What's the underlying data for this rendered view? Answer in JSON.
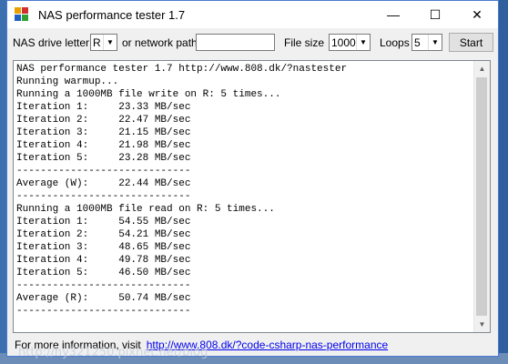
{
  "window": {
    "title": "NAS performance tester 1.7"
  },
  "titlebar": {
    "minimize": "—",
    "maximize": "☐",
    "close": "✕"
  },
  "toolbar": {
    "drive_label": "NAS drive letter",
    "drive_value": "R",
    "network_label": "or network path",
    "network_value": "",
    "filesize_label": "File size",
    "filesize_value": "1000",
    "loops_label": "Loops",
    "loops_value": "5",
    "start_label": "Start"
  },
  "output": {
    "lines": [
      "NAS performance tester 1.7 http://www.808.dk/?nastester",
      "Running warmup...",
      "Running a 1000MB file write on R: 5 times...",
      "Iteration 1:     23.33 MB/sec",
      "Iteration 2:     22.47 MB/sec",
      "Iteration 3:     21.15 MB/sec",
      "Iteration 4:     21.98 MB/sec",
      "Iteration 5:     23.28 MB/sec",
      "-----------------------------",
      "Average (W):     22.44 MB/sec",
      "-----------------------------",
      "Running a 1000MB file read on R: 5 times...",
      "Iteration 1:     54.55 MB/sec",
      "Iteration 2:     54.21 MB/sec",
      "Iteration 3:     48.65 MB/sec",
      "Iteration 4:     49.78 MB/sec",
      "Iteration 5:     46.50 MB/sec",
      "-----------------------------",
      "Average (R):     50.74 MB/sec",
      "-----------------------------"
    ]
  },
  "footer": {
    "text": "For more information, visit",
    "link": "http://www.808.dk/?code-csharp-nas-performance"
  },
  "watermark": "http://hy321250.pixnet.net/blog",
  "colors": {
    "link": "#0000ee",
    "window_border": "#4a7bd0"
  }
}
